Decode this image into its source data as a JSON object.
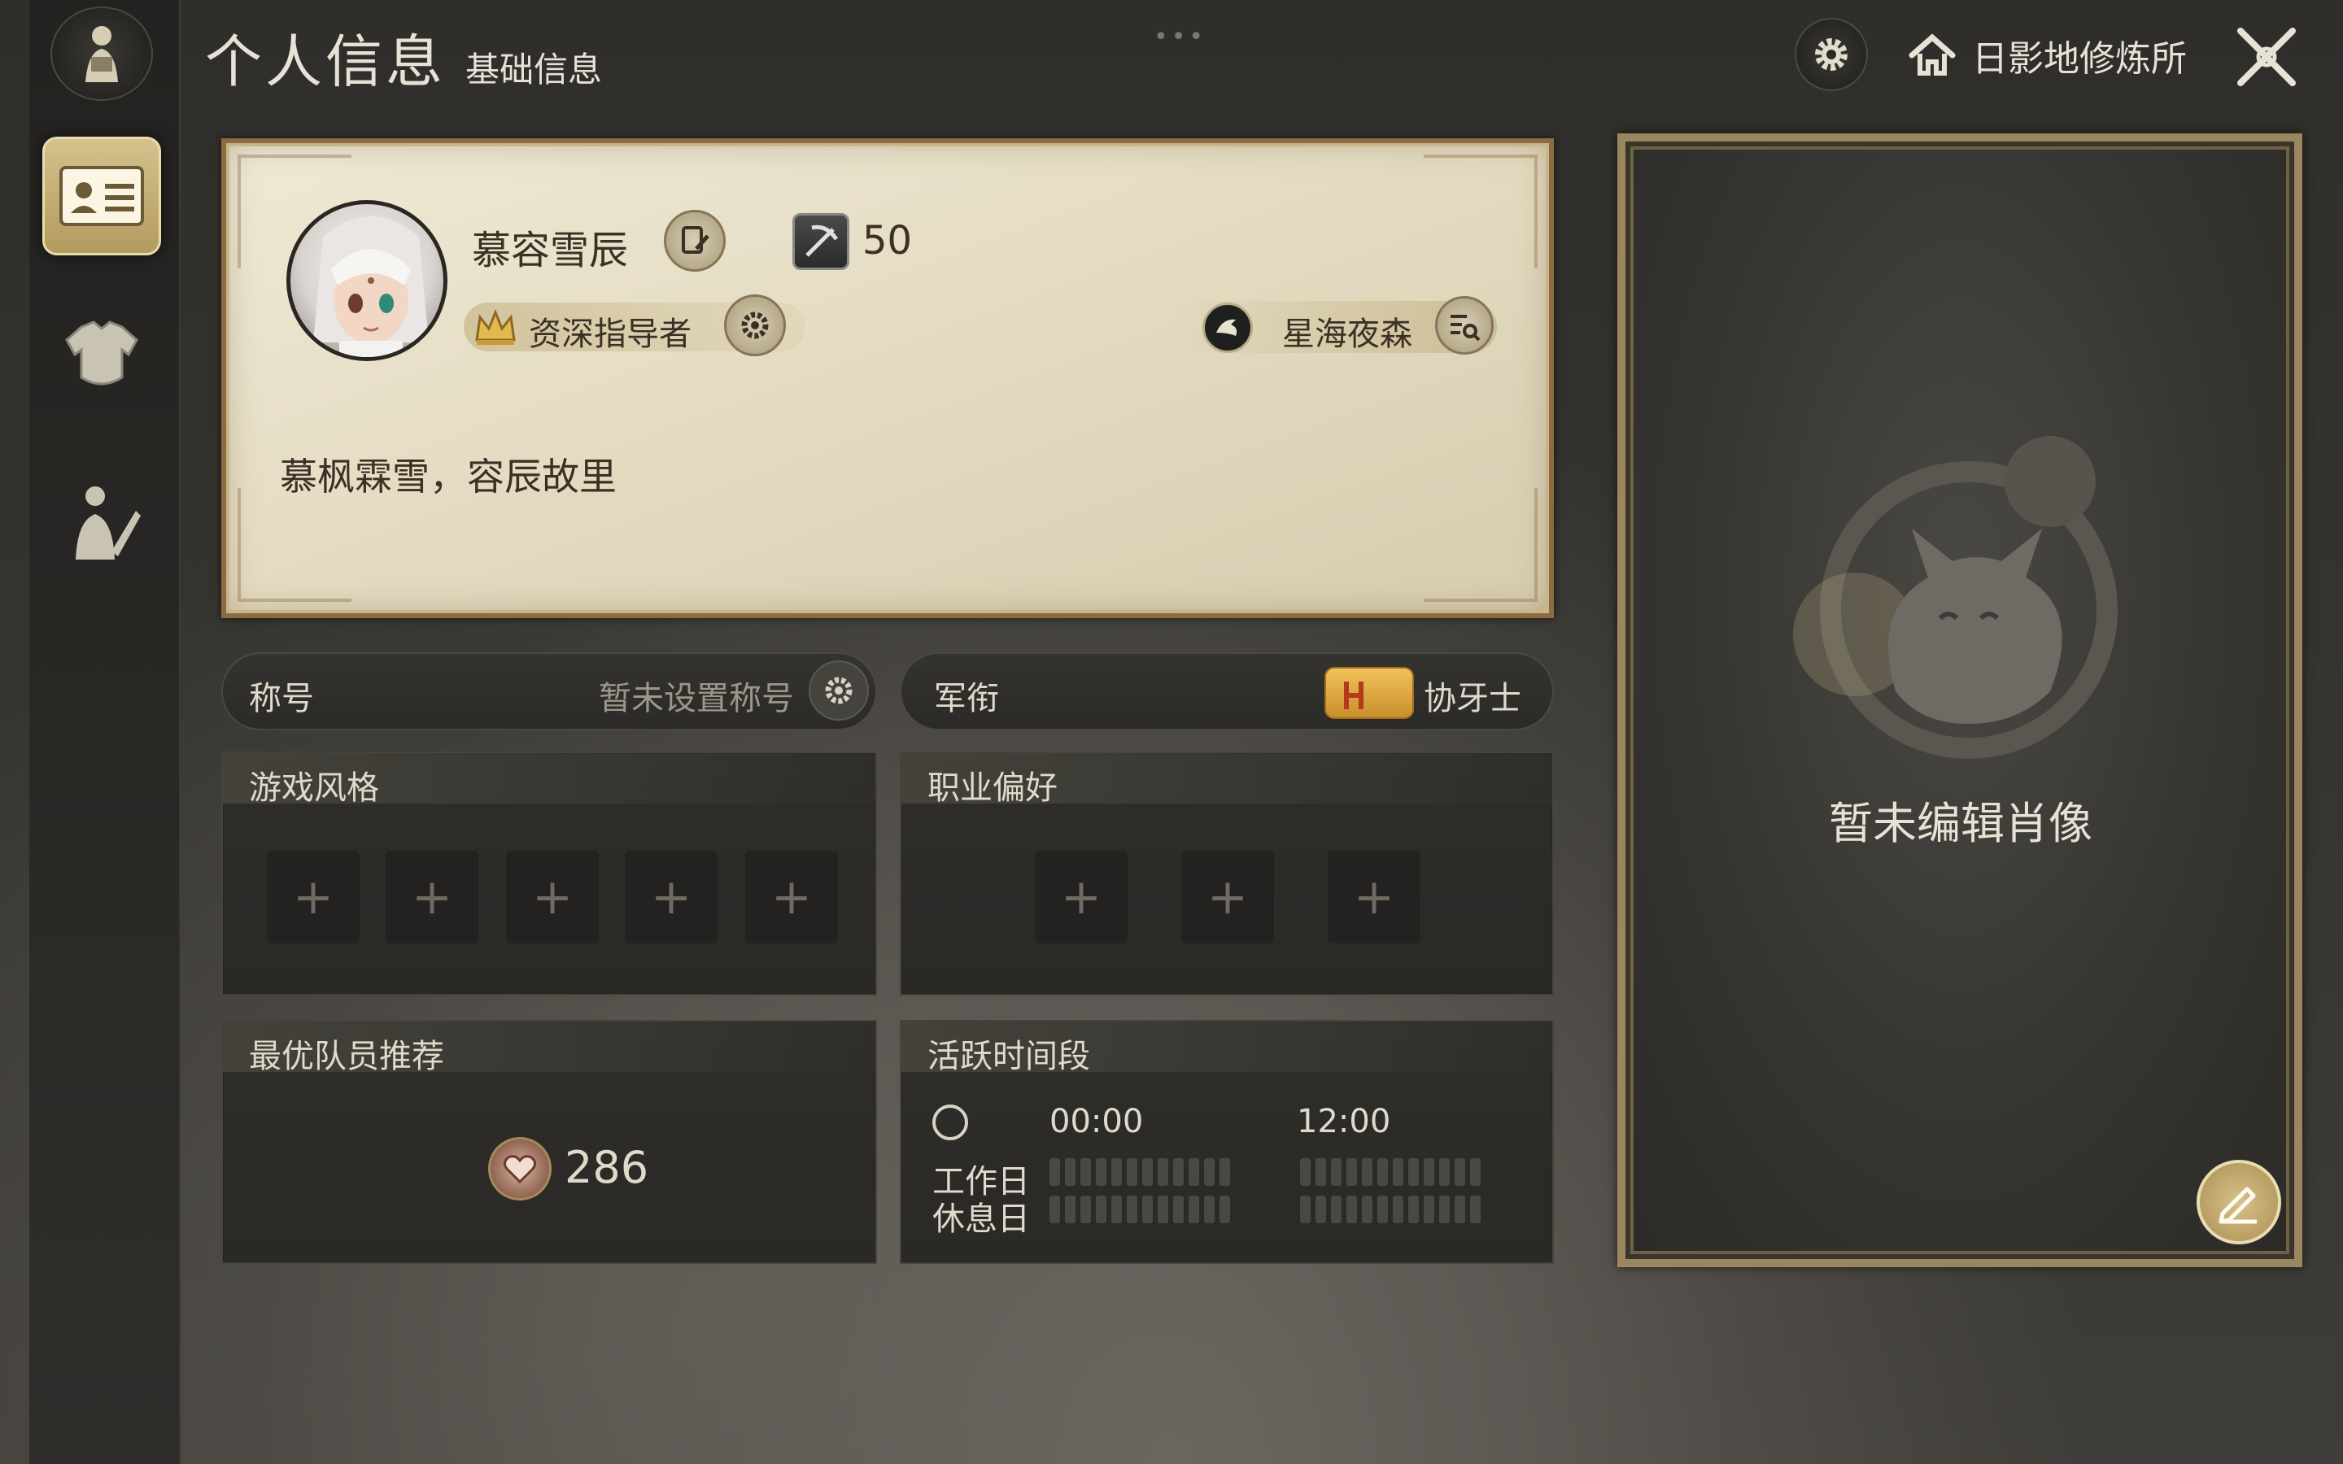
{
  "header": {
    "title": "个人信息",
    "subtitle": "基础信息",
    "location": "日影地修炼所",
    "icons": {
      "settings": "gear-icon",
      "home": "home-icon",
      "close": "close-icon"
    }
  },
  "sidebar": {
    "items": [
      {
        "name": "profile-card",
        "icon": "id-card-icon",
        "active": true
      },
      {
        "name": "armor",
        "icon": "armor-icon",
        "active": false
      },
      {
        "name": "portrait",
        "icon": "character-icon",
        "active": false
      }
    ]
  },
  "profile": {
    "name": "慕容雪辰",
    "level": "50",
    "mentor_title": "资深指导者",
    "server": "星海夜森",
    "bio": "慕枫霖雪，容辰故里"
  },
  "title_bar": {
    "label": "称号",
    "value": "暂未设置称号"
  },
  "rank_bar": {
    "label": "军衔",
    "value": "协牙士"
  },
  "play_style": {
    "title": "游戏风格",
    "slots": [
      "+",
      "+",
      "+",
      "+",
      "+"
    ]
  },
  "job_pref": {
    "title": "职业偏好",
    "slots": [
      "+",
      "+",
      "+"
    ]
  },
  "best_party": {
    "title": "最优队员推荐",
    "count": "286"
  },
  "active_time": {
    "title": "活跃时间段",
    "time_start": "00:00",
    "time_mid": "12:00",
    "workday": "工作日",
    "restday": "休息日"
  },
  "portrait": {
    "empty_text": "暂未编辑肖像"
  },
  "colors": {
    "accent_gold": "#b39b5f",
    "card_bg": "#e4dcc2",
    "text_light": "#e7e2d6"
  }
}
